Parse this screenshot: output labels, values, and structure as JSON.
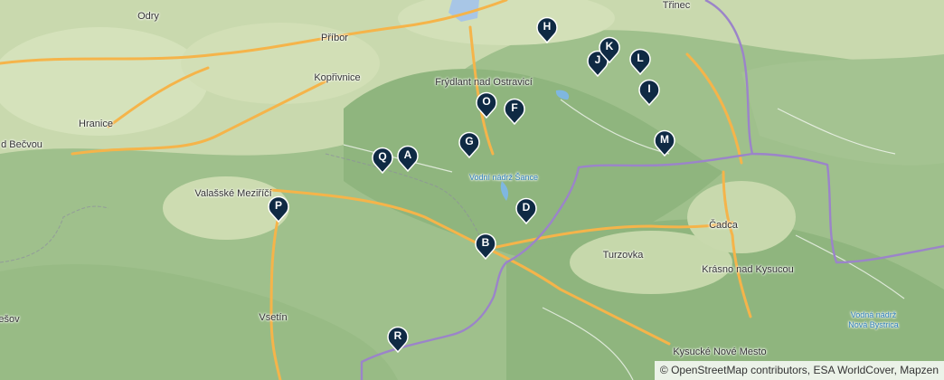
{
  "places": [
    {
      "id": "odry",
      "name": "Odry",
      "cls": ""
    },
    {
      "id": "pribor",
      "name": "Příbor",
      "cls": ""
    },
    {
      "id": "trinec",
      "name": "Třinec",
      "cls": ""
    },
    {
      "id": "koprivnice",
      "name": "Kopřivnice",
      "cls": ""
    },
    {
      "id": "frydlant",
      "name": "Frýdlant nad Ostravicí",
      "cls": ""
    },
    {
      "id": "hranice",
      "name": "Hranice",
      "cls": ""
    },
    {
      "id": "becvou",
      "name": "d Bečvou",
      "cls": ""
    },
    {
      "id": "valmez",
      "name": "Valašské Meziříčí",
      "cls": ""
    },
    {
      "id": "sance",
      "name": "Vodní nádrž Šance",
      "cls": "water"
    },
    {
      "id": "cadca",
      "name": "Čadca",
      "cls": ""
    },
    {
      "id": "turzovka",
      "name": "Turzovka",
      "cls": ""
    },
    {
      "id": "krasno",
      "name": "Krásno nad Kysucou",
      "cls": ""
    },
    {
      "id": "vsetin",
      "name": "Vsetín",
      "cls": ""
    },
    {
      "id": "ešov",
      "name": "ešov",
      "cls": ""
    },
    {
      "id": "kysucke",
      "name": "Kysucké Nové Mesto",
      "cls": ""
    },
    {
      "id": "novabystrica1",
      "name": "Vodná nádrž",
      "cls": "water"
    },
    {
      "id": "novabystrica2",
      "name": "Nová Bystrica",
      "cls": "water"
    }
  ],
  "markers": [
    {
      "label": "A"
    },
    {
      "label": "B"
    },
    {
      "label": "D"
    },
    {
      "label": "F"
    },
    {
      "label": "G"
    },
    {
      "label": "H"
    },
    {
      "label": "I"
    },
    {
      "label": "J"
    },
    {
      "label": "K"
    },
    {
      "label": "L"
    },
    {
      "label": "M"
    },
    {
      "label": "O"
    },
    {
      "label": "P"
    },
    {
      "label": "Q"
    },
    {
      "label": "R"
    }
  ],
  "colors": {
    "marker": "#0f2a44",
    "border": "#9b84c9",
    "road": "#f5b44a",
    "water": "#7fb7e0"
  },
  "attribution": "© OpenStreetMap contributors, ESA WorldCover, Mapzen"
}
